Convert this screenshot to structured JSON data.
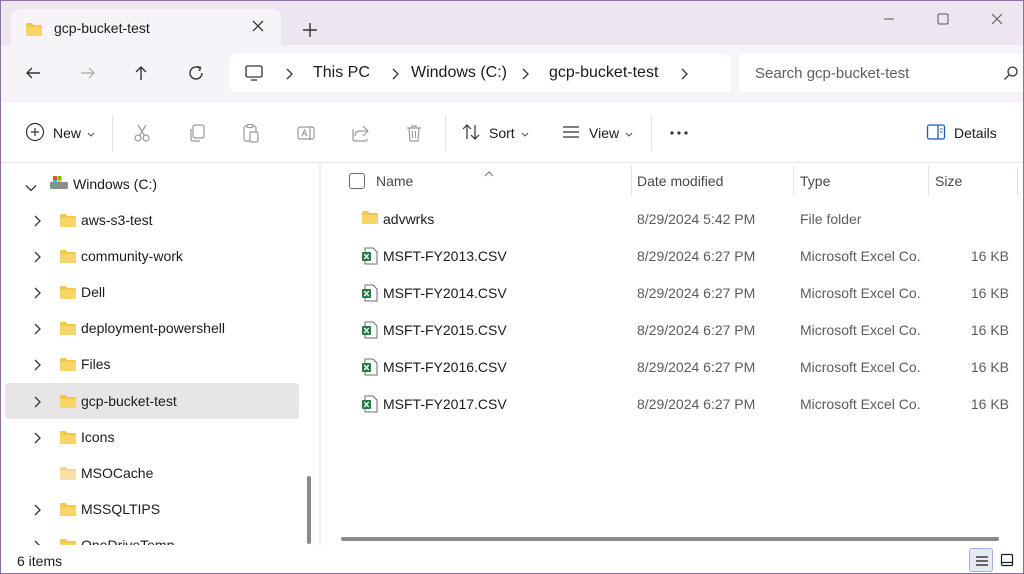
{
  "tab": {
    "title": "gcp-bucket-test"
  },
  "breadcrumb": {
    "items": [
      "This PC",
      "Windows (C:)",
      "gcp-bucket-test"
    ]
  },
  "search": {
    "placeholder": "Search gcp-bucket-test"
  },
  "toolbar": {
    "new_label": "New",
    "sort_label": "Sort",
    "view_label": "View",
    "details_label": "Details"
  },
  "nav": {
    "root": "Windows (C:)",
    "items": [
      {
        "label": "aws-s3-test"
      },
      {
        "label": "community-work"
      },
      {
        "label": "Dell"
      },
      {
        "label": "deployment-powershell"
      },
      {
        "label": "Files"
      },
      {
        "label": "gcp-bucket-test"
      },
      {
        "label": "Icons"
      },
      {
        "label": "MSOCache"
      },
      {
        "label": "MSSQLTIPS"
      },
      {
        "label": "OneDriveTemp"
      }
    ]
  },
  "columns": {
    "name": "Name",
    "date": "Date modified",
    "type": "Type",
    "size": "Size"
  },
  "files": [
    {
      "name": "advwrks",
      "date": "8/29/2024 5:42 PM",
      "type": "File folder",
      "size": "",
      "icon": "folder-icon"
    },
    {
      "name": "MSFT-FY2013.CSV",
      "date": "8/29/2024 6:27 PM",
      "type": "Microsoft Excel Co...",
      "size": "16 KB",
      "icon": "excel-icon"
    },
    {
      "name": "MSFT-FY2014.CSV",
      "date": "8/29/2024 6:27 PM",
      "type": "Microsoft Excel Co...",
      "size": "16 KB",
      "icon": "excel-icon"
    },
    {
      "name": "MSFT-FY2015.CSV",
      "date": "8/29/2024 6:27 PM",
      "type": "Microsoft Excel Co...",
      "size": "16 KB",
      "icon": "excel-icon"
    },
    {
      "name": "MSFT-FY2016.CSV",
      "date": "8/29/2024 6:27 PM",
      "type": "Microsoft Excel Co...",
      "size": "16 KB",
      "icon": "excel-icon"
    },
    {
      "name": "MSFT-FY2017.CSV",
      "date": "8/29/2024 6:27 PM",
      "type": "Microsoft Excel Co...",
      "size": "16 KB",
      "icon": "excel-icon"
    }
  ],
  "status": {
    "count": "6 items"
  },
  "colors": {
    "folder": "#f3c74a",
    "excel": "#1f7a44",
    "selection": "#e6e6e6",
    "accent": "#1a73e8"
  }
}
